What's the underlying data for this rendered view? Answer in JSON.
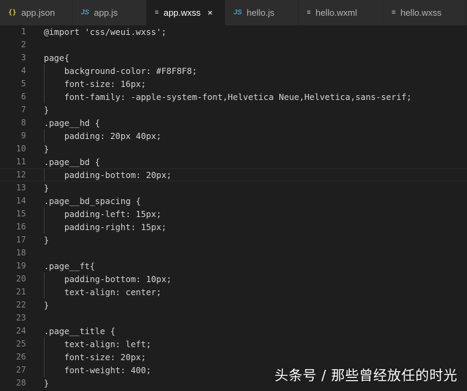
{
  "tabs": [
    {
      "label": "app.json",
      "icon": "json-file-icon",
      "glyph": "{}",
      "active": false,
      "width": 106
    },
    {
      "label": "app.js",
      "icon": "js-file-icon",
      "glyph": "JS",
      "active": false,
      "width": 108
    },
    {
      "label": "app.wxss",
      "icon": "lines-file-icon",
      "glyph": "≡",
      "active": true,
      "width": 115
    },
    {
      "label": "hello.js",
      "icon": "js-file-icon",
      "glyph": "JS",
      "active": false,
      "width": 107
    },
    {
      "label": "hello.wxml",
      "icon": "lines-file-icon",
      "glyph": "≡",
      "active": false,
      "width": 124
    },
    {
      "label": "hello.wxss",
      "icon": "lines-file-icon",
      "glyph": "≡",
      "active": false,
      "width": 122
    }
  ],
  "close_glyph": "×",
  "colors": {
    "tab_bar_bg": "#2d2d2d",
    "active_tab_bg": "#1e1e1e",
    "editor_bg": "#1e1e1e",
    "line_number": "#858585",
    "code_text": "#d4d4d4"
  },
  "editor": {
    "current_line": 12,
    "lines": [
      {
        "n": "1",
        "text": "@import 'css/weui.wxss';",
        "indent": 0
      },
      {
        "n": "2",
        "text": "",
        "indent": 0
      },
      {
        "n": "3",
        "text": "page{",
        "indent": 0
      },
      {
        "n": "4",
        "text": "    background-color: #F8F8F8;",
        "indent": 1
      },
      {
        "n": "5",
        "text": "    font-size: 16px;",
        "indent": 1
      },
      {
        "n": "6",
        "text": "    font-family: -apple-system-font,Helvetica Neue,Helvetica,sans-serif;",
        "indent": 1
      },
      {
        "n": "7",
        "text": "}",
        "indent": 0
      },
      {
        "n": "8",
        "text": ".page__hd {",
        "indent": 0
      },
      {
        "n": "9",
        "text": "    padding: 20px 40px;",
        "indent": 1
      },
      {
        "n": "10",
        "text": "}",
        "indent": 0
      },
      {
        "n": "11",
        "text": ".page__bd {",
        "indent": 0
      },
      {
        "n": "12",
        "text": "    padding-bottom: 20px;",
        "indent": 1
      },
      {
        "n": "13",
        "text": "}",
        "indent": 0
      },
      {
        "n": "14",
        "text": ".page__bd_spacing {",
        "indent": 0
      },
      {
        "n": "15",
        "text": "    padding-left: 15px;",
        "indent": 1
      },
      {
        "n": "16",
        "text": "    padding-right: 15px;",
        "indent": 1
      },
      {
        "n": "17",
        "text": "}",
        "indent": 0
      },
      {
        "n": "18",
        "text": "",
        "indent": 0
      },
      {
        "n": "19",
        "text": ".page__ft{",
        "indent": 0
      },
      {
        "n": "20",
        "text": "    padding-bottom: 10px;",
        "indent": 1
      },
      {
        "n": "21",
        "text": "    text-align: center;",
        "indent": 1
      },
      {
        "n": "22",
        "text": "}",
        "indent": 0
      },
      {
        "n": "23",
        "text": "",
        "indent": 0
      },
      {
        "n": "24",
        "text": ".page__title {",
        "indent": 0
      },
      {
        "n": "25",
        "text": "    text-align: left;",
        "indent": 1
      },
      {
        "n": "26",
        "text": "    font-size: 20px;",
        "indent": 1
      },
      {
        "n": "27",
        "text": "    font-weight: 400;",
        "indent": 1
      },
      {
        "n": "28",
        "text": "}",
        "indent": 0
      }
    ]
  },
  "watermark": "头条号 / 那些曾经放任的时光"
}
